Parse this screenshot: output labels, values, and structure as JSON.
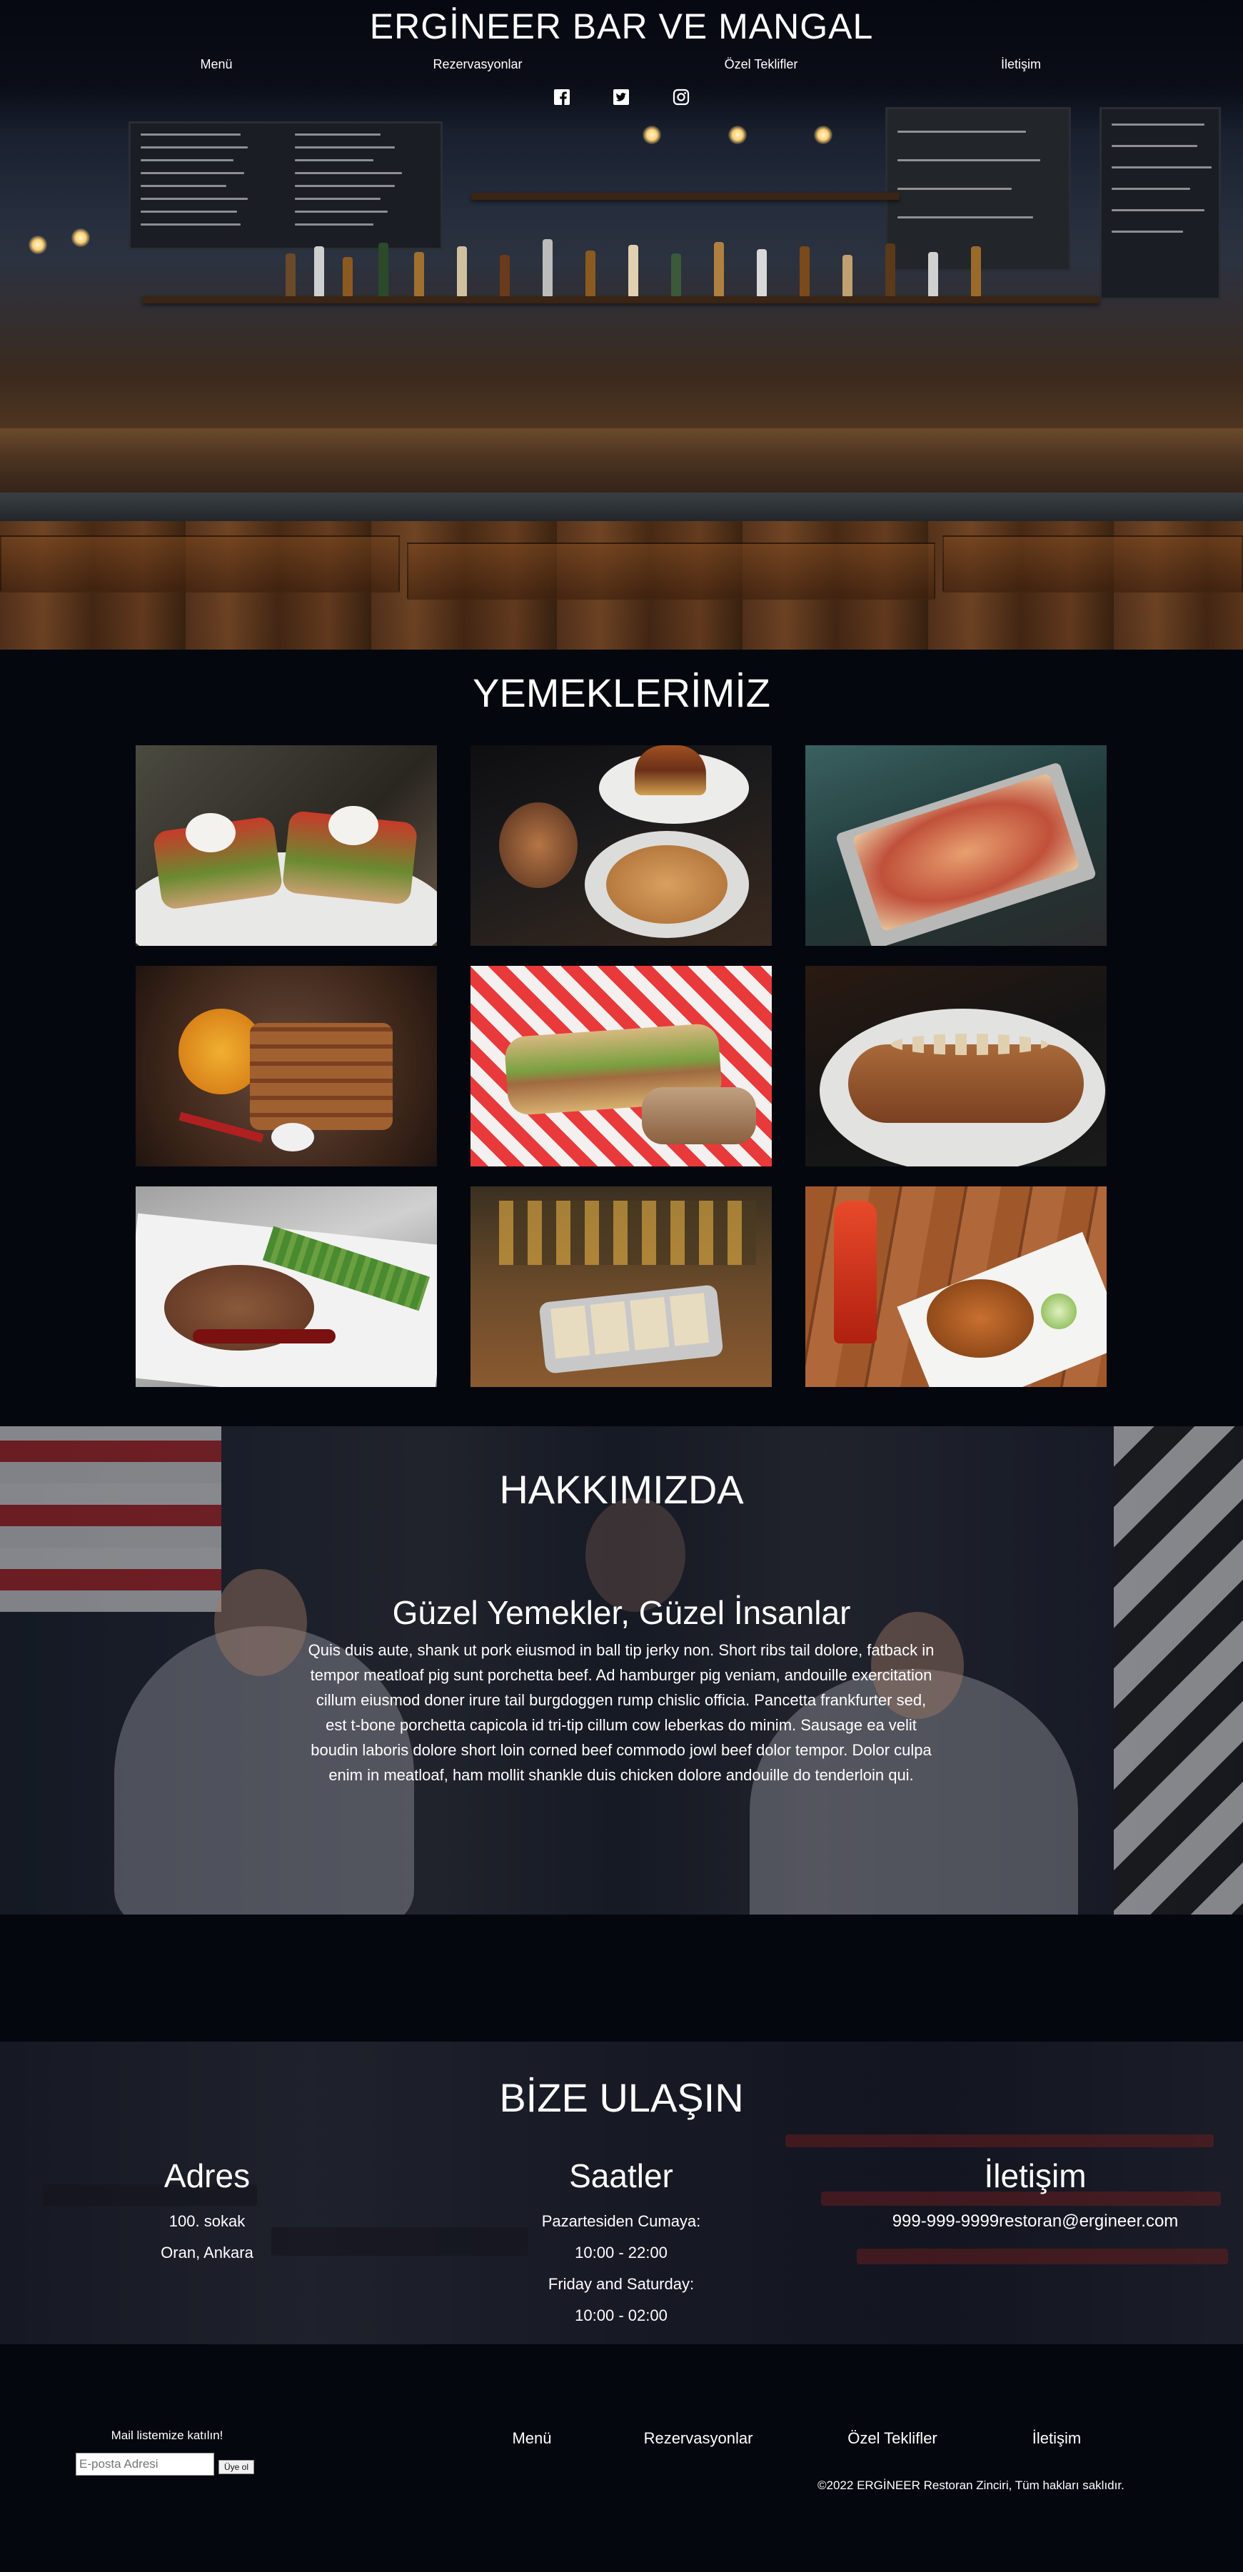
{
  "header": {
    "title": "ERGİNEER BAR VE MANGAL",
    "nav": [
      "Menü",
      "Rezervasyonlar",
      "Özel Teklifler",
      "İletişim"
    ],
    "social_icons": [
      "facebook-icon",
      "twitter-icon",
      "instagram-icon"
    ]
  },
  "food": {
    "title": "YEMEKLERİMİZ",
    "images": [
      "toast-with-eggs-image",
      "burger-and-casserole-image",
      "pizza-on-tray-image",
      "ribs-on-plate-image",
      "sandwich-on-checkered-cloth-image",
      "sausage-with-onion-rings-image",
      "steak-with-asparagus-image",
      "tacos-on-bar-image",
      "fried-wings-with-drink-image"
    ]
  },
  "about": {
    "title": "HAKKIMIZDA",
    "subtitle": "Güzel Yemekler, Güzel İnsanlar",
    "text": "Quis duis aute, shank ut pork eiusmod in ball tip jerky non. Short ribs tail dolore, fatback in tempor meatloaf pig sunt porchetta beef. Ad hamburger pig veniam, andouille exercitation cillum eiusmod doner irure tail burgdoggen rump chislic officia. Pancetta frankfurter sed, est t-bone porchetta capicola id tri-tip cillum cow leberkas do minim. Sausage ea velit boudin laboris dolore short loin corned beef commodo jowl beef dolor tempor. Dolor culpa enim in meatloaf, ham mollit shankle duis chicken dolore andouille do tenderloin qui."
  },
  "contact": {
    "title": "BİZE ULAŞIN",
    "address": {
      "heading": "Adres",
      "line1": "100. sokak",
      "line2": "Oran, Ankara"
    },
    "hours": {
      "heading": "Saatler",
      "line1": "Pazartesiden Cumaya:",
      "line2": "10:00 - 22:00",
      "line3": "Friday and Saturday:",
      "line4": "10:00 - 02:00"
    },
    "info": {
      "heading": "İletişim",
      "phone": "999-999-9999",
      "email": "restoran@ergineer.com"
    }
  },
  "footer": {
    "newsletter_label": "Mail listemize katılın!",
    "email_placeholder": "E-posta Adresi",
    "subscribe_label": "Üye ol",
    "nav": [
      "Menü",
      "Rezervasyonlar",
      "Özel Teklifler",
      "İletişim"
    ],
    "copyright": "©2022 ERGİNEER Restoran Zinciri, Tüm hakları saklıdır."
  }
}
